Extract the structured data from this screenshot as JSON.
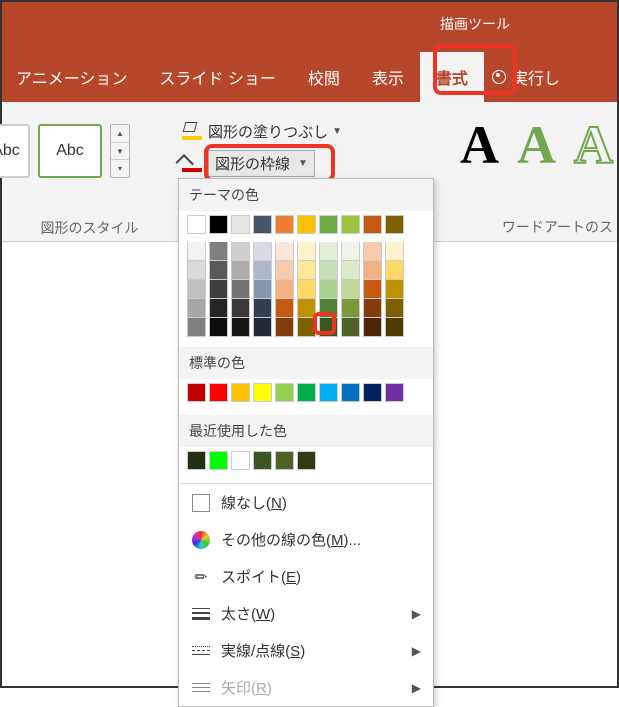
{
  "ribbon": {
    "contextual_label": "描画ツール",
    "tabs": {
      "animation": "アニメーション",
      "slideshow": "スライド ショー",
      "review": "校閲",
      "view": "表示",
      "format": "書式",
      "tellme": "実行し"
    }
  },
  "styles_group": {
    "sample_text": "Abc",
    "label": "図形のスタイル"
  },
  "fill_menu": {
    "label": "図形の塗りつぶし"
  },
  "outline_menu": {
    "label": "図形の枠線"
  },
  "wordart_group": {
    "glyph": "A",
    "label": "ワードアートのス"
  },
  "color_panel": {
    "theme_title": "テーマの色",
    "standard_title": "標準の色",
    "recent_title": "最近使用した色",
    "theme_colors_header": [
      "#ffffff",
      "#000000",
      "#e7e6e6",
      "#44546a",
      "#ed7d31",
      "#ffc000",
      "#70ad47",
      "#9cc53d",
      "#c45911",
      "#7f6000"
    ],
    "theme_colors_tints": [
      [
        "#f2f2f2",
        "#7f7f7f",
        "#d0cece",
        "#d6dce5",
        "#fbe5d6",
        "#fff2cc",
        "#e2f0d9",
        "#ecf5e7",
        "#f7cbac",
        "#fff2cc"
      ],
      [
        "#d9d9d9",
        "#595959",
        "#aeabab",
        "#adb9ca",
        "#f8cbad",
        "#ffe699",
        "#c5e0b4",
        "#dbebc7",
        "#f4b183",
        "#ffd966"
      ],
      [
        "#bfbfbf",
        "#3f3f3f",
        "#757070",
        "#8497b0",
        "#f4b183",
        "#ffd966",
        "#a9d18e",
        "#c1da9a",
        "#c55a11",
        "#bf9000"
      ],
      [
        "#a6a6a6",
        "#262626",
        "#3a3838",
        "#323f4f",
        "#c55a11",
        "#bf9000",
        "#548235",
        "#7a9a3a",
        "#843c0c",
        "#7f6000"
      ],
      [
        "#7f7f7f",
        "#0d0d0d",
        "#171616",
        "#222a35",
        "#843c0c",
        "#7f6000",
        "#385723",
        "#4e6225",
        "#4d2408",
        "#4f3b00"
      ]
    ],
    "standard_colors": [
      "#c00000",
      "#ff0000",
      "#ffc000",
      "#ffff00",
      "#92d050",
      "#00b050",
      "#00b0f0",
      "#0070c0",
      "#002060",
      "#7030a0"
    ],
    "recent_colors": [
      "#203010",
      "#00ff00",
      "#ffffff",
      "#385723",
      "#4e6225",
      "#2f3b17"
    ],
    "selected_swatch": {
      "row": 4,
      "col": 6
    }
  },
  "menu_items": {
    "no_line": "線なし(",
    "no_line_u": "N",
    "no_line_end": ")",
    "more_colors": "その他の線の色(",
    "more_colors_u": "M",
    "more_colors_end": ")...",
    "eyedropper": "スポイト(",
    "eyedropper_u": "E",
    "eyedropper_end": ")",
    "weight": "太さ(",
    "weight_u": "W",
    "weight_end": ")",
    "dashes": "実線/点線(",
    "dashes_u": "S",
    "dashes_end": ")",
    "arrows": "矢印(",
    "arrows_u": "R",
    "arrows_end": ")"
  }
}
